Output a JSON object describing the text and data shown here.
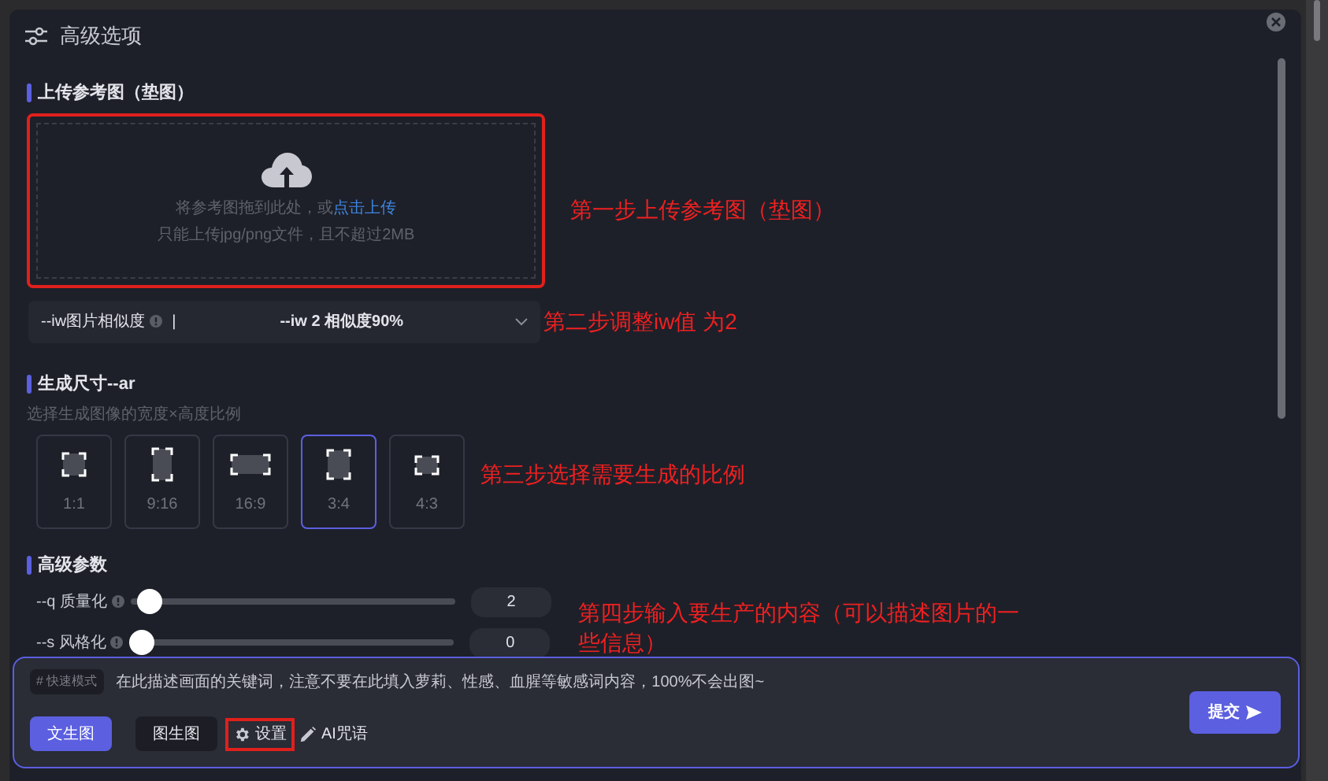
{
  "dialog": {
    "title": "高级选项"
  },
  "upload": {
    "label": "上传参考图（垫图）",
    "prompt": "将参考图拖到此处，或",
    "link": "点击上传",
    "hint": "只能上传jpg/png文件，且不超过2MB",
    "highlighted": true
  },
  "iw_select": {
    "label": "--iw图片相似度",
    "separator": "|",
    "value": "--iw 2 相似度90%"
  },
  "size": {
    "label": "生成尺寸--ar",
    "hint": "选择生成图像的宽度×高度比例",
    "ratios": [
      {
        "label": "1:1",
        "selected": false
      },
      {
        "label": "9:16",
        "selected": false
      },
      {
        "label": "16:9",
        "selected": false
      },
      {
        "label": "3:4",
        "selected": true
      },
      {
        "label": "4:3",
        "selected": false
      }
    ]
  },
  "params": {
    "label": "高级参数",
    "sliders": [
      {
        "label": "--q 质量化",
        "level": 0.02,
        "value": "2"
      },
      {
        "label": "--s 风格化",
        "level": 0,
        "value": "0"
      }
    ]
  },
  "prompt_bar": {
    "mode_tag": "# 快速模式",
    "placeholder": "在此描述画面的关键词，注意不要在此填入萝莉、性感、血腥等敏感词内容，100%不会出图~",
    "tabs": [
      {
        "label": "文生图",
        "selected": true
      },
      {
        "label": "图生图",
        "selected": false
      }
    ],
    "settings": {
      "label": "设置",
      "highlighted": true
    },
    "ai_spell": "AI咒语",
    "submit": "提交"
  },
  "annotations": [
    "第一步上传参考图（垫图）",
    "第二步调整iw值 为2",
    "第三步选择需要生成的比例",
    "第四步输入要生产的内容（可以描述图片的一些信息）"
  ]
}
